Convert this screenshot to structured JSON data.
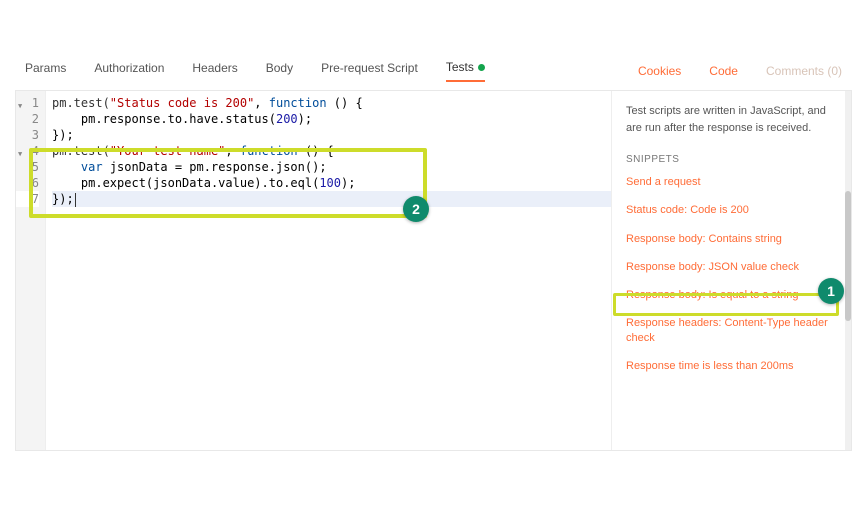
{
  "tabs": {
    "params": "Params",
    "authorization": "Authorization",
    "headers": "Headers",
    "body": "Body",
    "prerequest": "Pre-request Script",
    "tests": "Tests"
  },
  "links": {
    "cookies": "Cookies",
    "code": "Code",
    "comments": "Comments (0)"
  },
  "gutter": [
    "1",
    "2",
    "3",
    "4",
    "5",
    "6",
    "7"
  ],
  "code": {
    "l1a": "pm.test(",
    "l1b": "\"Status code is 200\"",
    "l1c": ", ",
    "l1d": "function",
    "l1e": " () {",
    "l2a": "    pm.response.to.have.status(",
    "l2b": "200",
    "l2c": ");",
    "l3": "});",
    "l4a": "pm.test(",
    "l4b": "\"Your test name\"",
    "l4c": ", ",
    "l4d": "function",
    "l4e": " () {",
    "l5a": "    ",
    "l5b": "var",
    "l5c": " jsonData = pm.response.json();",
    "l6a": "    pm.expect(jsonData.value).to.eql(",
    "l6b": "100",
    "l6c": ");",
    "l7": "});"
  },
  "side": {
    "intro": "Test scripts are written in JavaScript, and are run after the response is received.",
    "heading": "SNIPPETS",
    "snippets": [
      "Send a request",
      "Status code: Code is 200",
      "Response body: Contains string",
      "Response body: JSON value check",
      "Response body: Is equal to a string",
      "Response headers: Content-Type header check",
      "Response time is less than 200ms"
    ]
  },
  "badges": {
    "one": "1",
    "two": "2"
  }
}
